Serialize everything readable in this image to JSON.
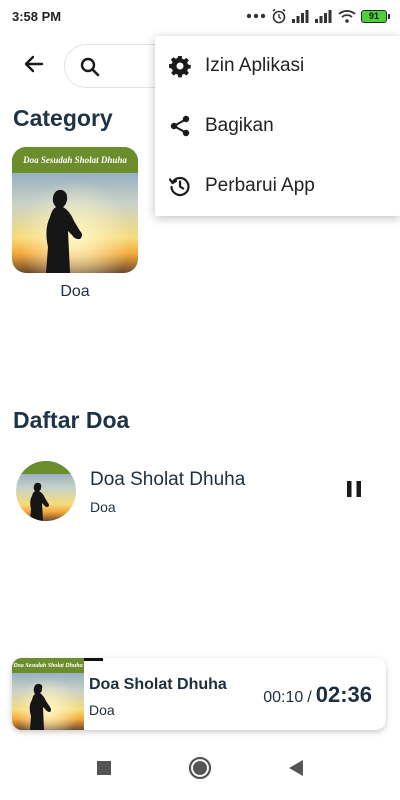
{
  "status_bar": {
    "time": "3:58 PM",
    "battery": "91",
    "icons": [
      "dots-icon",
      "alarm-icon",
      "signal-icon",
      "signal-icon",
      "wifi-icon",
      "battery-icon"
    ]
  },
  "toolbar": {
    "back_icon": "arrow-left-icon",
    "search": {
      "icon": "search-icon",
      "placeholder": "",
      "value": ""
    }
  },
  "category_section": {
    "title": "Category",
    "items": [
      {
        "label": "Doa",
        "banner": "Doa Sesudah Sholat Dhuha"
      }
    ]
  },
  "list_section": {
    "title": "Daftar Doa",
    "items": [
      {
        "title": "Doa Sholat Dhuha",
        "subtitle": "Doa",
        "action_icon": "pause-icon"
      }
    ]
  },
  "mini_player": {
    "banner": "Doa Sesudah Sholat Dhuha",
    "title": "Doa Sholat Dhuha",
    "subtitle": "Doa",
    "current_time": "00:10",
    "separator": "/",
    "total_time": "02:36",
    "progress_fraction": 0.064
  },
  "menu": {
    "items": [
      {
        "label": "Izin Aplikasi",
        "icon": "gear-icon"
      },
      {
        "label": "Bagikan",
        "icon": "share-icon"
      },
      {
        "label": "Perbarui App",
        "icon": "history-icon"
      }
    ]
  },
  "nav_bar": {
    "icons": [
      "square-icon",
      "home-circle-icon",
      "back-triangle-icon"
    ]
  },
  "colors": {
    "title": "#1f3347",
    "banner_green": "#6c8d2c",
    "battery_green": "#4cd137"
  }
}
